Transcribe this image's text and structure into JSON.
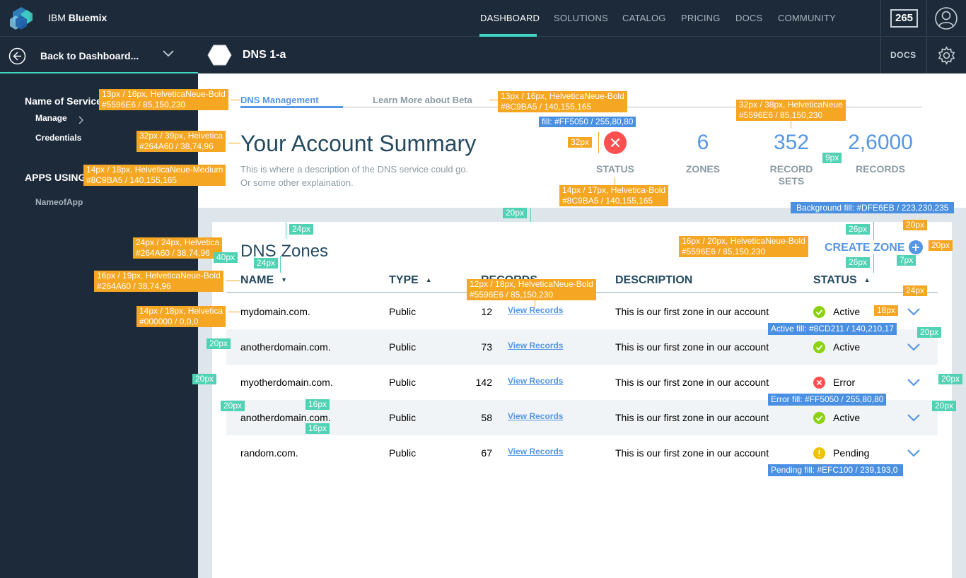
{
  "header": {
    "brand_prefix": "IBM",
    "brand_name": "Bluemix",
    "nav": [
      "DASHBOARD",
      "SOLUTIONS",
      "CATALOG",
      "PRICING",
      "DOCS",
      "COMMUNITY"
    ],
    "active_nav": "DASHBOARD",
    "badge": "265"
  },
  "subheader": {
    "back_label": "Back to Dashboard...",
    "service_name": "DNS 1-a",
    "docs_label": "DOCS"
  },
  "sidebar": {
    "section1": "Name of Service",
    "manage": "Manage",
    "credentials": "Credentials",
    "section2": "APPS USING",
    "app": "NameofApp"
  },
  "summary": {
    "tab_active": "DNS Management",
    "tab_other": "Learn More about Beta",
    "title": "Your Account Summary",
    "desc_line1": "This is where a description of the DNS service could go.",
    "desc_line2": "Or some other explaination.",
    "status_label": "STATUS",
    "zones_value": "6",
    "zones_label": "ZONES",
    "recordsets_value": "352",
    "recordsets_label1": "RECORD",
    "recordsets_label2": "SETS",
    "records_value": "2,6000",
    "records_label": "RECORDS"
  },
  "zones": {
    "title": "DNS Zones",
    "create_label": "CREATE ZONE",
    "columns": {
      "name": "NAME",
      "type": "TYPE",
      "records": "RECORDS",
      "description": "DESCRIPTION",
      "status": "STATUS"
    },
    "rows": [
      {
        "name": "mydomain.com.",
        "type": "Public",
        "records": "12",
        "link": "View Records",
        "description": "This is our first zone in our account",
        "status": "Active"
      },
      {
        "name": "anotherdomain.com.",
        "type": "Public",
        "records": "73",
        "link": "View Records",
        "description": "This is our first zone in our account",
        "status": "Active"
      },
      {
        "name": "myotherdomain.com.",
        "type": "Public",
        "records": "142",
        "link": "View Records",
        "description": "This is our first zone in our account",
        "status": "Error"
      },
      {
        "name": "anotherdomain.com.",
        "type": "Public",
        "records": "58",
        "link": "View Records",
        "description": "This is our first zone in our account",
        "status": "Active"
      },
      {
        "name": "random.com.",
        "type": "Public",
        "records": "67",
        "link": "View Records",
        "description": "This is our first zone in our account",
        "status": "Pending"
      }
    ]
  },
  "colors": {
    "active": "#8CD211",
    "error": "#FF5050",
    "pending": "#EFC100",
    "accent": "#5596E6",
    "teal": "#41D6C3",
    "background": "#DFE6EB"
  },
  "annotations": {
    "a_tab": [
      "13px / 16px, HelveticaNeue-Bold",
      "#5596E6 / 85,150,230"
    ],
    "a_tab_beta": [
      "13px / 16px, HelveticaNeue-Bold",
      "#8C9BA5 / 140,155,165"
    ],
    "a_stat": [
      "32px / 38px, HelveticaNeue",
      "#5596E6 / 85,150,230"
    ],
    "a_fill_x": "fill: #FF5050 / 255,80,80",
    "a_title": [
      "32px / 39px, Helvetica",
      "#264A60 / 38,74,96"
    ],
    "a_desc": [
      "14px / 18px, HelveticaNeue-Medium",
      "#8C9BA5 / 140,155,165"
    ],
    "a_statlbl": [
      "14px / 17px, Helvetica-Bold",
      "#8C9BA5 / 140,155,165"
    ],
    "a_bg": "Background fill: #DFE6EB / 223,230,235",
    "a_zones": [
      "24px / 24px, Helvetica",
      "#264A60 / 38,74,96"
    ],
    "a_create": [
      "16px / 20px, HelveticaNeue-Bold",
      "#5596E6 / 85,150,230"
    ],
    "a_th": [
      "16px / 19px, HelveticaNeue-Bold",
      "#264A60 / 38,74,96"
    ],
    "a_link": [
      "12px / 18px, HelveticaNeue-Bold",
      "#5596E6 / 85,150,230"
    ],
    "a_cell": [
      "14px / 18px, Helvetica",
      "#000000 / 0,0,0"
    ],
    "a_active": "Active fill: #8CD211 / 140,210,17",
    "a_error": "Error fill: #FF5050 / 255,80,80",
    "a_pending": "Pending fill: #EFC100 / 239,193,0",
    "m_32": "32px",
    "m_20": "20px",
    "m_24": "24px",
    "m_40": "40px",
    "m_26": "26px",
    "m_7": "7px",
    "m_9": "9px",
    "m_18": "18px",
    "m_16": "16px"
  }
}
